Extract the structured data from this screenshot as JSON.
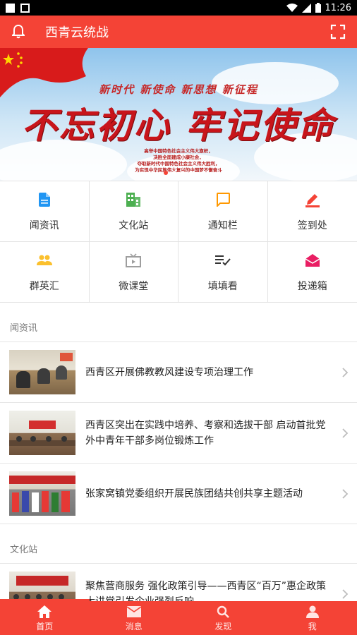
{
  "status_bar": {
    "time": "11:26"
  },
  "app_bar": {
    "title": "西青云统战"
  },
  "banner": {
    "slogan_top": "新时代 新使命 新思想 新征程",
    "slogan_main": "不忘初心 牢记使命",
    "lines": [
      "高举中国特色社会主义伟大旗帜，",
      "决胜全面建成小康社会，",
      "夺取新时代中国特色社会主义伟大胜利，",
      "为实现中华民族伟大复兴的中国梦不懈奋斗"
    ]
  },
  "grid": [
    {
      "label": "闻资讯",
      "icon": "document-icon",
      "color": "#2196f3"
    },
    {
      "label": "文化站",
      "icon": "building-icon",
      "color": "#4caf50"
    },
    {
      "label": "通知栏",
      "icon": "message-icon",
      "color": "#ff9800"
    },
    {
      "label": "签到处",
      "icon": "pen-icon",
      "color": "#f44336"
    },
    {
      "label": "群英汇",
      "icon": "people-icon",
      "color": "#fbc02d"
    },
    {
      "label": "微课堂",
      "icon": "tv-icon",
      "color": "#9e9e9e"
    },
    {
      "label": "填填看",
      "icon": "checklist-icon",
      "color": "#333333"
    },
    {
      "label": "投递箱",
      "icon": "mail-icon",
      "color": "#e91e63"
    }
  ],
  "sections": [
    {
      "header": "闻资讯",
      "items": [
        {
          "title": "西青区开展佛教教风建设专项治理工作"
        },
        {
          "title": "西青区突出在实践中培养、考察和选拔干部 启动首批党外中青年干部多岗位锻炼工作"
        },
        {
          "title": "张家窝镇党委组织开展民族团结共创共享主题活动"
        }
      ]
    },
    {
      "header": "文化站",
      "items": [
        {
          "title": "聚焦营商服务 强化政策引导——西青区“百万”惠企政策大讲堂引发企业强烈反响"
        }
      ]
    }
  ],
  "tabs": [
    {
      "label": "首页",
      "icon": "home-icon",
      "active": true
    },
    {
      "label": "消息",
      "icon": "mail-icon",
      "active": false
    },
    {
      "label": "发现",
      "icon": "search-icon",
      "active": false
    },
    {
      "label": "我",
      "icon": "person-icon",
      "active": false
    }
  ],
  "colors": {
    "primary": "#f44336"
  }
}
